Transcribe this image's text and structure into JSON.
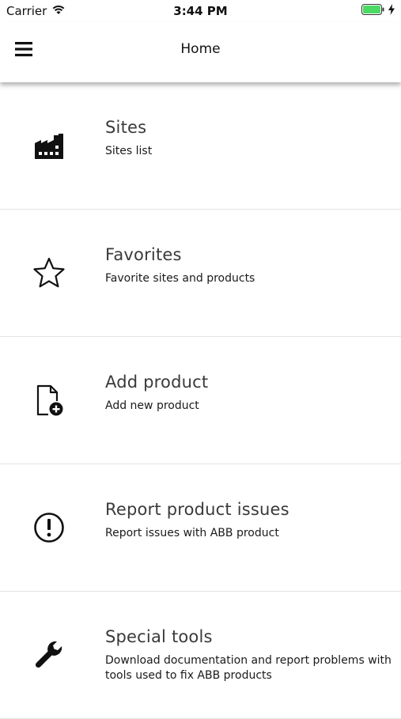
{
  "status_bar": {
    "carrier": "Carrier",
    "time": "3:44 PM"
  },
  "header": {
    "title": "Home",
    "menu_icon": "hamburger-menu-icon"
  },
  "menu": {
    "items": [
      {
        "title": "Sites",
        "subtitle": "Sites list",
        "icon": "factory-icon"
      },
      {
        "title": "Favorites",
        "subtitle": "Favorite sites and products",
        "icon": "star-icon"
      },
      {
        "title": "Add product",
        "subtitle": "Add new product",
        "icon": "add-document-icon"
      },
      {
        "title": "Report product issues",
        "subtitle": "Report issues with ABB product",
        "icon": "exclamation-circle-icon"
      },
      {
        "title": "Special tools",
        "subtitle": "Download documentation and report problems with tools used to fix ABB products",
        "icon": "wrench-icon"
      }
    ]
  },
  "colors": {
    "battery": "#4cd964",
    "text": "#1f1f1f",
    "divider": "#e3e3e3"
  }
}
